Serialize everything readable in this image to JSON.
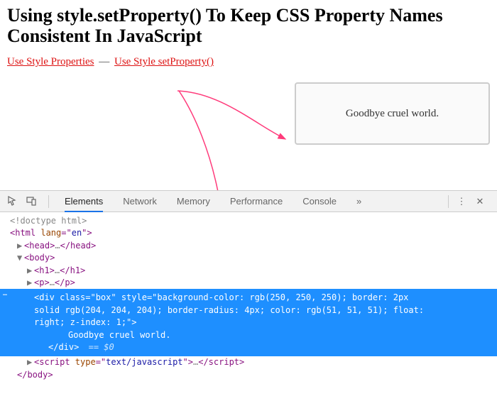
{
  "page": {
    "title": "Using style.setProperty() To Keep CSS Property Names Consistent In JavaScript",
    "link1": "Use Style Properties",
    "sep": "—",
    "link2": "Use Style setProperty()",
    "box_text": "Goodbye cruel world."
  },
  "devtools": {
    "tabs": [
      "Elements",
      "Network",
      "Memory",
      "Performance",
      "Console"
    ],
    "active_tab": 0,
    "more_glyph": "»",
    "menu_glyph": "⋮",
    "close_glyph": "✕"
  },
  "dom": {
    "doctype": "<!doctype html>",
    "html_open": "<html lang=\"en\">",
    "head": {
      "open": "<head>",
      "ell": "…",
      "close": "</head>"
    },
    "body_open": "<body>",
    "h1": {
      "open": "<h1>",
      "ell": "…",
      "close": "</h1>"
    },
    "p": {
      "open": "<p>",
      "ell": "…",
      "close": "</p>"
    },
    "hl_badge": "…",
    "hl_text_1": "<div class=\"box\" style=\"background-color: rgb(250, 250, 250); border: 2px",
    "hl_text_2": "solid rgb(204, 204, 204); border-radius: 4px; color: rgb(51, 51, 51); float:",
    "hl_text_3": "right; z-index: 1;\">",
    "hl_inner": "Goodbye cruel world.",
    "hl_close": "</div>",
    "eq0": "== $0",
    "script": {
      "open": "<script type=\"text/javascript\">",
      "ell": "…",
      "close": "</script>"
    },
    "body_close": "</body>"
  }
}
